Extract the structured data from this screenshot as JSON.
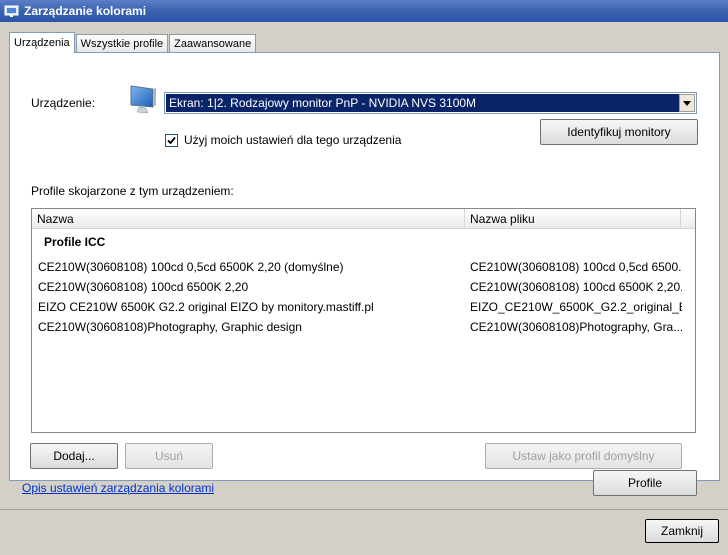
{
  "window": {
    "title": "Zarządzanie kolorami"
  },
  "tabs": [
    {
      "label": "Urządzenia",
      "active": true
    },
    {
      "label": "Wszystkie profile",
      "active": false
    },
    {
      "label": "Zaawansowane",
      "active": false
    }
  ],
  "device": {
    "label": "Urządzenie:",
    "selected": "Ekran: 1|2. Rodzajowy monitor PnP - NVIDIA NVS 3100M",
    "use_my_settings_label": "Użyj moich ustawień dla tego urządzenia",
    "use_my_settings_checked": true,
    "identify_button": "Identyfikuj monitory"
  },
  "profiles": {
    "section_label": "Profile skojarzone z tym urządzeniem:",
    "columns": [
      "Nazwa",
      "Nazwa pliku"
    ],
    "group": "Profile ICC",
    "rows": [
      {
        "name": "CE210W(30608108) 100cd 0,5cd 6500K 2,20 (domyślne)",
        "file": "CE210W(30608108) 100cd 0,5cd 6500..."
      },
      {
        "name": "CE210W(30608108) 100cd 6500K 2,20",
        "file": "CE210W(30608108) 100cd 6500K 2,20...."
      },
      {
        "name": "EIZO CE210W 6500K G2.2 original EIZO by monitory.mastiff.pl",
        "file": "EIZO_CE210W_6500K_G2.2_original_E..."
      },
      {
        "name": "CE210W(30608108)Photography, Graphic design",
        "file": "CE210W(30608108)Photography, Gra..."
      }
    ]
  },
  "buttons": {
    "add": "Dodaj...",
    "remove": "Usuń",
    "set_default": "Ustaw jako profil domyślny",
    "profiles": "Profile",
    "close": "Zamknij"
  },
  "link": {
    "text": "Opis ustawień zarządzania kolorami"
  },
  "colors": {
    "selection": "#0a246a",
    "link": "#0033cc",
    "titlebar": "#3b62b0"
  }
}
